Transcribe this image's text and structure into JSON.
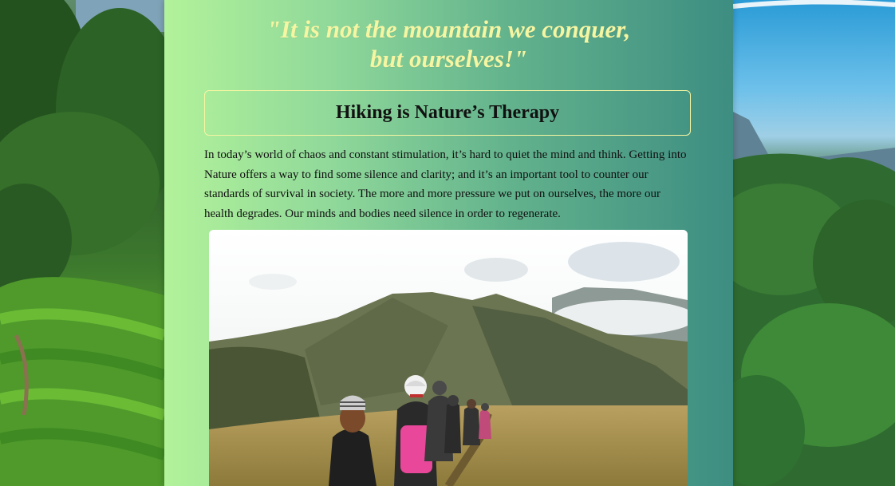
{
  "quote": {
    "line1": "\"It is not the mountain we conquer,",
    "line2": "but ourselves!\""
  },
  "section": {
    "heading": "Hiking is Nature’s Therapy",
    "paragraph": "In today’s world of chaos and constant stimulation, it’s hard to quiet the mind and think. Getting into Nature offers a way to find some silence and clarity; and it’s an important tool to counter our standards of survival in society. The more and more pressure we put on ourselves, the more our health degrades. Our minds and bodies need silence in order to regenerate."
  },
  "colors": {
    "quote_text": "#f6f5a2",
    "panel_start": "#b2f29a",
    "panel_end": "#3d8d82",
    "heading_border": "#f6f5a2"
  },
  "images": {
    "hero_photo": "hikers-on-mountain-ridge",
    "left_background": "tea-plantation-forest",
    "right_background": "mountain-forest-sky"
  }
}
